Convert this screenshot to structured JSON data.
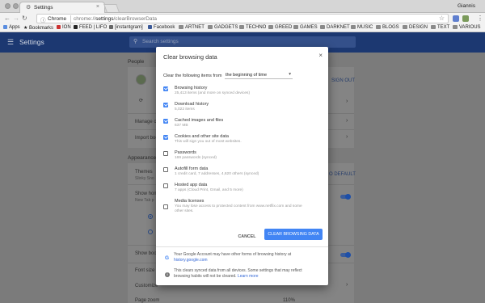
{
  "browser": {
    "tab_title": "Settings",
    "user_name": "Giannis",
    "omnibox": {
      "chip": "Chrome",
      "url_scheme": "chrome://",
      "url_host": "settings",
      "url_path": "/clearBrowserData"
    }
  },
  "bookmarks": [
    {
      "label": "Apps",
      "icon": "apps-icon"
    },
    {
      "label": "Bookmarks",
      "icon": "star-icon"
    },
    {
      "label": "ION",
      "icon": "favicon"
    },
    {
      "label": "FEED | LIFO",
      "icon": "favicon"
    },
    {
      "label": "[instantgram]",
      "icon": "favicon"
    },
    {
      "label": "Facebook",
      "icon": "facebook-icon"
    },
    {
      "label": "ARTNET",
      "icon": "folder-icon"
    },
    {
      "label": "GADGETS",
      "icon": "folder-icon"
    },
    {
      "label": "TECHNO",
      "icon": "folder-icon"
    },
    {
      "label": "GREED",
      "icon": "folder-icon"
    },
    {
      "label": "GAMES",
      "icon": "folder-icon"
    },
    {
      "label": "DARKNET",
      "icon": "folder-icon"
    },
    {
      "label": "MUSIC",
      "icon": "folder-icon"
    },
    {
      "label": "BLOGS",
      "icon": "folder-icon"
    },
    {
      "label": "DESIGN",
      "icon": "folder-icon"
    },
    {
      "label": "TEXT",
      "icon": "folder-icon"
    },
    {
      "label": "VARIOUS",
      "icon": "folder-icon"
    }
  ],
  "settings": {
    "title": "Settings",
    "search_placeholder": "Search settings",
    "sections": {
      "people": "People",
      "appearance": "Appearance"
    },
    "people_rows": {
      "sign_out": "SIGN OUT",
      "manage": "Manage ot",
      "import": "Import boo"
    },
    "appearance_rows": {
      "themes": "Themes",
      "themes_sub": "Slinky Sno",
      "themes_action": "O DEFAULT",
      "show_home": "Show home",
      "show_home_sub": "New Tab p",
      "show_bookmarks": "Show book",
      "font_size": "Font size",
      "customize": "Customize",
      "page_zoom": "Page zoom",
      "page_zoom_value": "110%"
    }
  },
  "dialog": {
    "title": "Clear browsing data",
    "range_label": "Clear the following items from",
    "range_value": "the beginning of time",
    "items": [
      {
        "label": "Browsing history",
        "detail": "25,413 items (and more on synced devices)",
        "detail2": "",
        "checked": true
      },
      {
        "label": "Download history",
        "detail": "5,022 items",
        "detail2": "",
        "checked": true
      },
      {
        "label": "Cached images and files",
        "detail": "637 MB",
        "detail2": "",
        "checked": true
      },
      {
        "label": "Cookies and other site data",
        "detail": "This will sign you out of most websites.",
        "detail2": "",
        "checked": true
      },
      {
        "label": "Passwords",
        "detail": "169 passwords (synced)",
        "detail2": "",
        "checked": false
      },
      {
        "label": "Autofill form data",
        "detail": "1 credit card, 7 addresses, 4,620 others (synced)",
        "detail2": "",
        "checked": false
      },
      {
        "label": "Hosted app data",
        "detail": "7 apps (Cloud Print, Gmail, and 5 more)",
        "detail2": "",
        "checked": false
      },
      {
        "label": "Media licenses",
        "detail": "You may lose access to protected content from www.netflix.com and some",
        "detail2": "other sites.",
        "checked": false
      }
    ],
    "cancel_label": "CANCEL",
    "clear_label": "CLEAR BROWSING DATA",
    "footer_google": {
      "line1": "Your Google Account may have other forms of browsing history at",
      "link": "history.google.com"
    },
    "footer_info": {
      "line1": "This clears synced data from all devices. Some settings that may reflect",
      "line2_prefix": "browsing habits will not be cleared.",
      "link": "Learn more"
    }
  },
  "colors": {
    "accent": "#4285f4",
    "header": "#1c3871",
    "link": "#3367d6"
  }
}
